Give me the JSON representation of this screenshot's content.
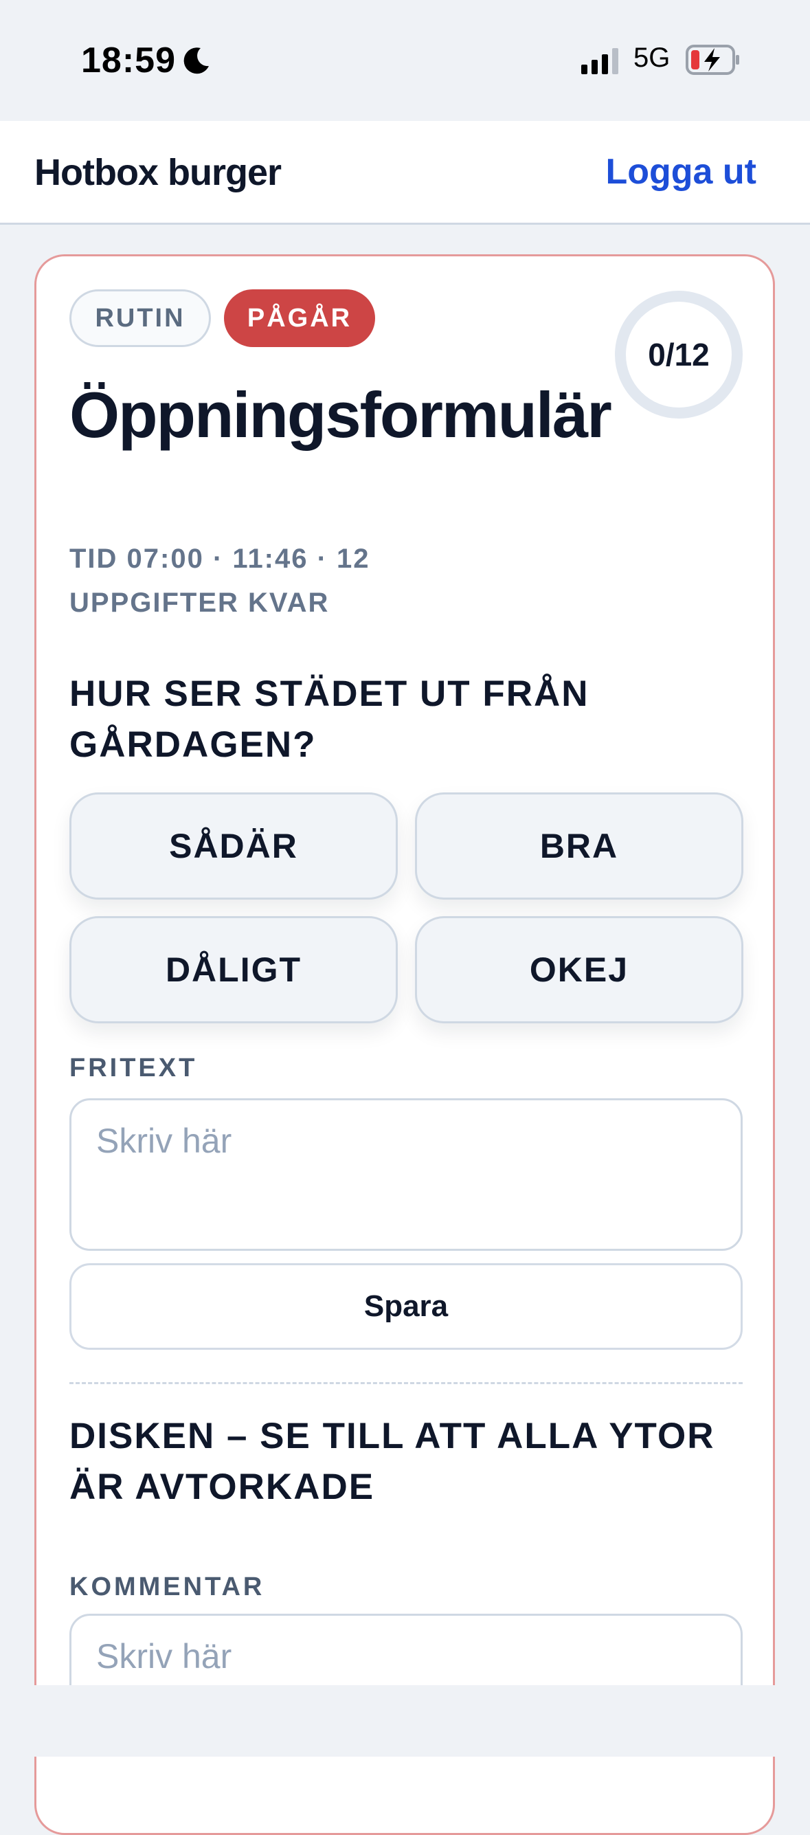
{
  "status_bar": {
    "time": "18:59",
    "network": "5G"
  },
  "header": {
    "brand": "Hotbox burger",
    "logout_label": "Logga ut"
  },
  "card": {
    "badges": {
      "type": "RUTIN",
      "state": "PÅGÅR"
    },
    "progress": "0/12",
    "title": "Öppningsformulär",
    "meta": "TID 07:00 · 11:46 · 12 UPPGIFTER KVAR",
    "task1": {
      "question": "HUR SER STÄDET UT FRÅN GÅRDAGEN?",
      "options": [
        "SÅDÄR",
        "BRA",
        "DÅLIGT",
        "OKEJ"
      ],
      "field_label": "FRITEXT",
      "placeholder": "Skriv här",
      "save_label": "Spara"
    },
    "task2": {
      "question": "DISKEN – SE TILL ATT ALLA YTOR ÄR AVTORKADE",
      "field_label": "KOMMENTAR",
      "placeholder": "Skriv här"
    }
  },
  "colors": {
    "accent": "#1d4ed8",
    "danger": "#cd4545",
    "card_border": "#e59a9a"
  }
}
